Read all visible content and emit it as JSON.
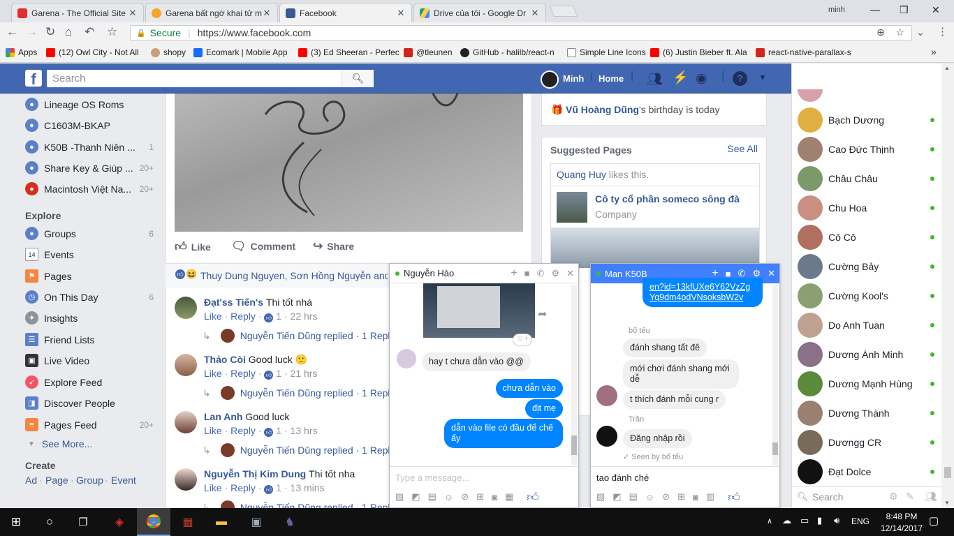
{
  "browser": {
    "tabs": [
      {
        "title": "Garena - The Official Site",
        "color": "#e02d2d"
      },
      {
        "title": "Garena bất ngờ khai tử m",
        "color": "#f4a62a"
      },
      {
        "title": "Facebook",
        "color": "#3b5998"
      },
      {
        "title": "Drive của tôi - Google Dr",
        "color": "#1fa463"
      }
    ],
    "user": "minh",
    "secure_label": "Secure",
    "url": "https://www.facebook.com",
    "bookmarks": [
      {
        "label": "Apps",
        "color": "#e94235"
      },
      {
        "label": "(12) Owl City - Not All",
        "color": "#ff0000"
      },
      {
        "label": "shopy",
        "color": "#c8a07a"
      },
      {
        "label": "Ecomark | Mobile App",
        "color": "#1769ff"
      },
      {
        "label": "(3) Ed Sheeran - Perfec",
        "color": "#ff0000"
      },
      {
        "label": "@tleunen",
        "color": "#d0241d"
      },
      {
        "label": "GitHub - halilb/react-n",
        "color": "#222222"
      },
      {
        "label": "Simple Line Icons",
        "color": "#888888"
      },
      {
        "label": "(6) Justin Bieber ft. Ala",
        "color": "#ff0000"
      },
      {
        "label": "react-native-parallax-s",
        "color": "#d0241d"
      }
    ]
  },
  "fb_header": {
    "search_placeholder": "Search",
    "user": "Minh",
    "home": "Home"
  },
  "left_nav": {
    "groups": [
      {
        "label": "Lineage OS Roms",
        "count": ""
      },
      {
        "label": "C1603M-BKAP",
        "count": ""
      },
      {
        "label": "K50B -Thanh Niên ...",
        "count": "1"
      },
      {
        "label": "Share Key & Giúp ...",
        "count": "20+"
      },
      {
        "label": "Macintosh Việt Na...",
        "count": "20+"
      }
    ],
    "explore_heading": "Explore",
    "explore": [
      {
        "label": "Groups",
        "count": "6"
      },
      {
        "label": "Events",
        "count": ""
      },
      {
        "label": "Pages",
        "count": ""
      },
      {
        "label": "On This Day",
        "count": "6"
      },
      {
        "label": "Insights",
        "count": ""
      },
      {
        "label": "Friend Lists",
        "count": ""
      },
      {
        "label": "Live Video",
        "count": ""
      },
      {
        "label": "Explore Feed",
        "count": ""
      },
      {
        "label": "Discover People",
        "count": ""
      },
      {
        "label": "Pages Feed",
        "count": "20+"
      }
    ],
    "see_more": "See More...",
    "create_heading": "Create",
    "create_links": [
      "Ad",
      "Page",
      "Group",
      "Event"
    ]
  },
  "post": {
    "actions": {
      "like": "Like",
      "comment": "Comment",
      "share": "Share"
    },
    "reactions_text": "Thuy Dung Nguyen, Sơn Hồng Nguyễn and",
    "comments": [
      {
        "name": "Đạt'ss Tiến's",
        "text": "Thi tốt nhá",
        "emoji": "",
        "likes": "1",
        "time": "22 hrs",
        "reply_text": "Nguyễn Tiến Dũng replied · 1 Reply"
      },
      {
        "name": "Thảo Còi",
        "text": "Good luck",
        "emoji": "🙂",
        "likes": "1",
        "time": "21 hrs",
        "reply_text": "Nguyễn Tiến Dũng replied · 1 Reply"
      },
      {
        "name": "Lan Anh",
        "text": "Good luck",
        "emoji": "",
        "likes": "1",
        "time": "13 hrs",
        "reply_text": "Nguyễn Tiến Dũng replied · 1 Reply"
      },
      {
        "name": "Nguyễn Thị Kim Dung",
        "text": "Thi tốt nha",
        "emoji": "",
        "likes": "1",
        "time": "13 mins",
        "reply_text": "Nguyễn Tiến Dũng replied · 1 Reply"
      }
    ],
    "like_label": "Like",
    "reply_label": "Reply"
  },
  "right_col": {
    "birthday_name": "Vũ Hoàng Dũng",
    "birthday_suffix": "'s birthday is today",
    "suggested_title": "Suggested Pages",
    "see_all": "See All",
    "liker": "Quang Huy",
    "likes_this": " likes this.",
    "page_name": "Cô ty cổ phần someco sông đà",
    "page_type": "Company"
  },
  "chat_hao": {
    "name": "Nguyễn Hào",
    "messages": [
      {
        "from": "them",
        "text": "hay t chưa dẫn vào @@"
      },
      {
        "from": "me",
        "text": "chưa dẫn vào"
      },
      {
        "from": "me",
        "text": "địt mẹ"
      },
      {
        "from": "me",
        "text": "dẫn vào file có đầu để chế ấy"
      }
    ],
    "placeholder": "Type a message..."
  },
  "chat_k50b": {
    "name": "Man K50B",
    "link_text": "en?id=13kfUXe6Y62VzZgYq9dm4pdVNsoksbW2v",
    "sender1": "bổ tểu",
    "messages1": [
      "đánh shang tất đê",
      "mới chơi đánh shang mới dễ",
      "t thích đánh mỗi cung r"
    ],
    "sender2": "Trần",
    "messages2": [
      "Đăng nhập rồi"
    ],
    "seen_by": "Seen by bổ tểu",
    "input_value": "tao đánh ché"
  },
  "chat_sidebar": {
    "contacts": [
      "Bạch Dương",
      "Cao Đức Thịnh",
      "Châu Châu",
      "Chu Hoa",
      "Cô Cô",
      "Cường Bảy",
      "Cường Kool's",
      "Do Anh Tuan",
      "Dương Ánh Minh",
      "Dương Mạnh Hùng",
      "Dương Thành",
      "Dươngg CR",
      "Đạt Dolce"
    ],
    "search_placeholder": "Search"
  },
  "taskbar": {
    "lang": "ENG",
    "time": "8:48 PM",
    "date": "12/14/2017"
  }
}
